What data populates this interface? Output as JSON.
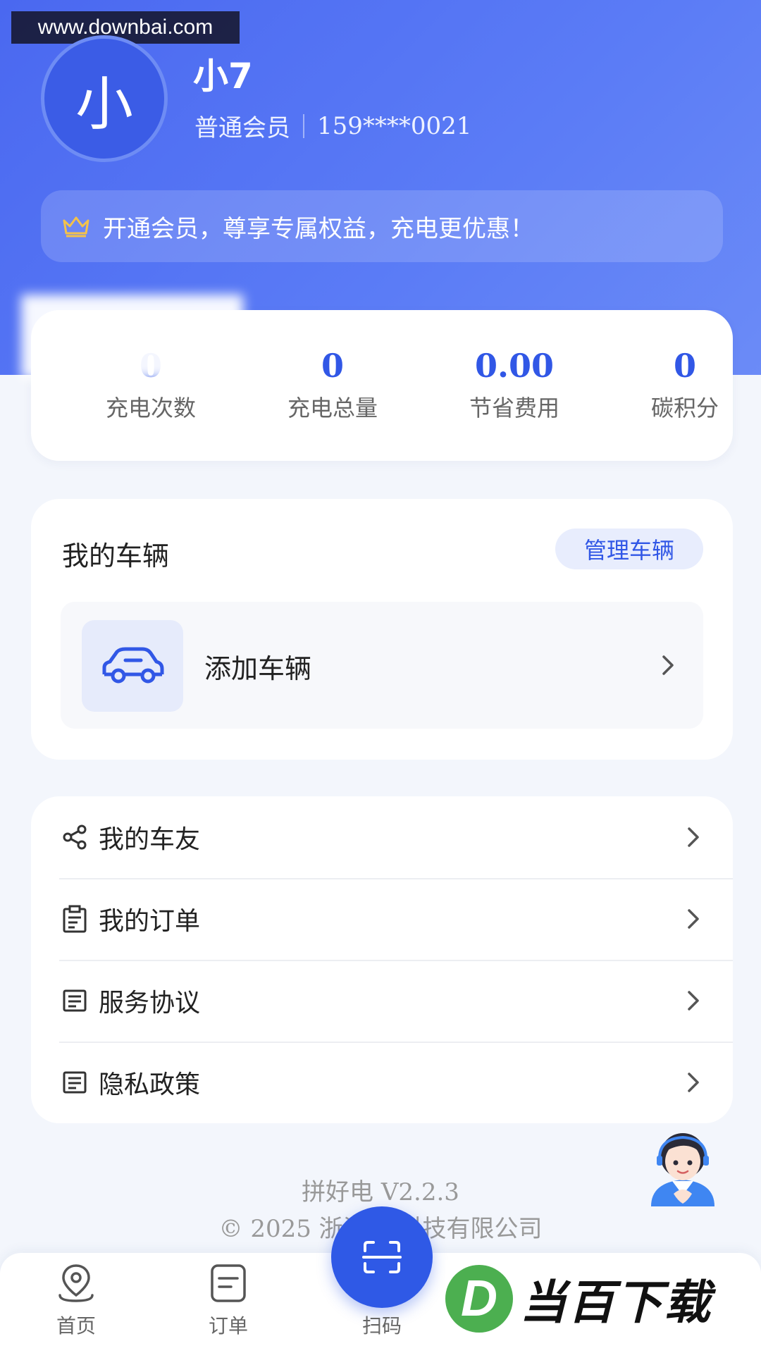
{
  "watermark_url": "www.downbai.com",
  "profile": {
    "avatar_char": "小",
    "name": "小7",
    "level": "普通会员",
    "phone": "159****0021"
  },
  "vip_banner": {
    "text": "开通会员，尊享专属权益，充电更优惠！",
    "icon": "crown-icon"
  },
  "stats": [
    {
      "value": "0",
      "label": "充电次数"
    },
    {
      "value": "0",
      "label": "充电总量"
    },
    {
      "value": "0.00",
      "label": "节省费用"
    },
    {
      "value": "0",
      "label": "碳积分"
    }
  ],
  "vehicles": {
    "title": "我的车辆",
    "manage_label": "管理车辆",
    "add_label": "添加车辆"
  },
  "menu": [
    {
      "label": "我的车友",
      "icon": "share-icon"
    },
    {
      "label": "我的订单",
      "icon": "clipboard-icon"
    },
    {
      "label": "服务协议",
      "icon": "document-icon"
    },
    {
      "label": "隐私政策",
      "icon": "document-icon"
    }
  ],
  "footer": {
    "version": "拼好电 V2.2.3",
    "copyright": "© 2025 浙江拼  科技有限公司"
  },
  "tabbar": {
    "home": "首页",
    "orders": "订单",
    "scan": "扫码"
  },
  "brand_watermark": {
    "logo": "D",
    "text": "当百下载"
  },
  "colors": {
    "primary": "#3157e6",
    "hero": "#5b7cf6",
    "background": "#f3f6fc"
  }
}
